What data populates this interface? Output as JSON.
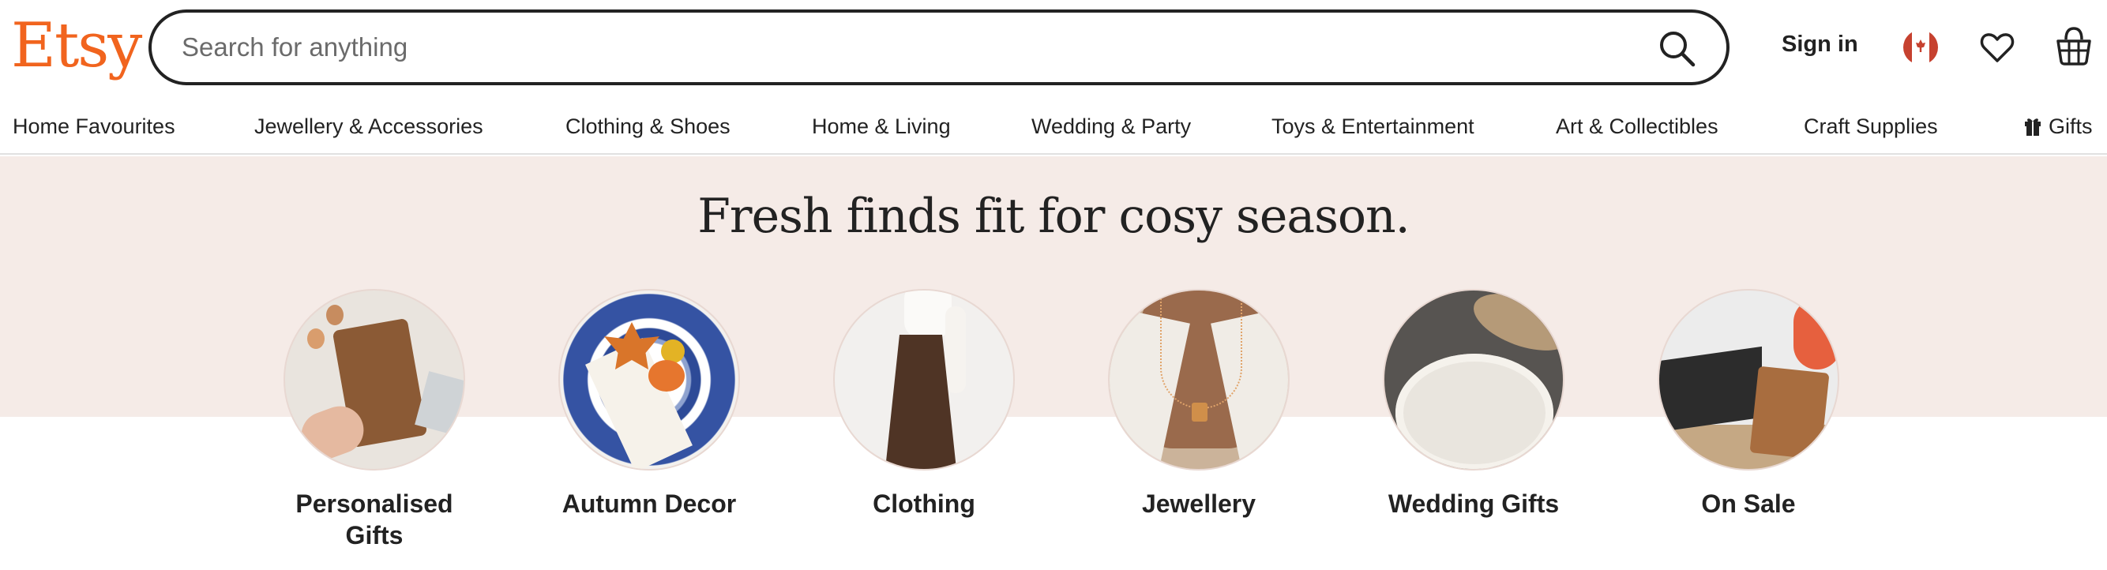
{
  "header": {
    "logo": "Etsy",
    "search_placeholder": "Search for anything",
    "sign_in": "Sign in"
  },
  "nav": {
    "items": [
      "Home Favourites",
      "Jewellery & Accessories",
      "Clothing & Shoes",
      "Home & Living",
      "Wedding & Party",
      "Toys & Entertainment",
      "Art & Collectibles",
      "Craft Supplies",
      "Gifts"
    ]
  },
  "hero": {
    "headline": "Fresh finds fit for cosy season.",
    "categories": [
      {
        "line1": "Personalised",
        "line2": "Gifts"
      },
      {
        "line1": "Autumn Decor",
        "line2": ""
      },
      {
        "line1": "Clothing",
        "line2": ""
      },
      {
        "line1": "Jewellery",
        "line2": ""
      },
      {
        "line1": "Wedding Gifts",
        "line2": ""
      },
      {
        "line1": "On Sale",
        "line2": ""
      }
    ]
  },
  "icons": [
    "search-icon",
    "canada-flag-icon",
    "heart-icon",
    "basket-icon",
    "gift-icon"
  ],
  "colors": {
    "brand": "#F1641E",
    "hero_background": "#F5EBE7",
    "text": "#222222"
  }
}
